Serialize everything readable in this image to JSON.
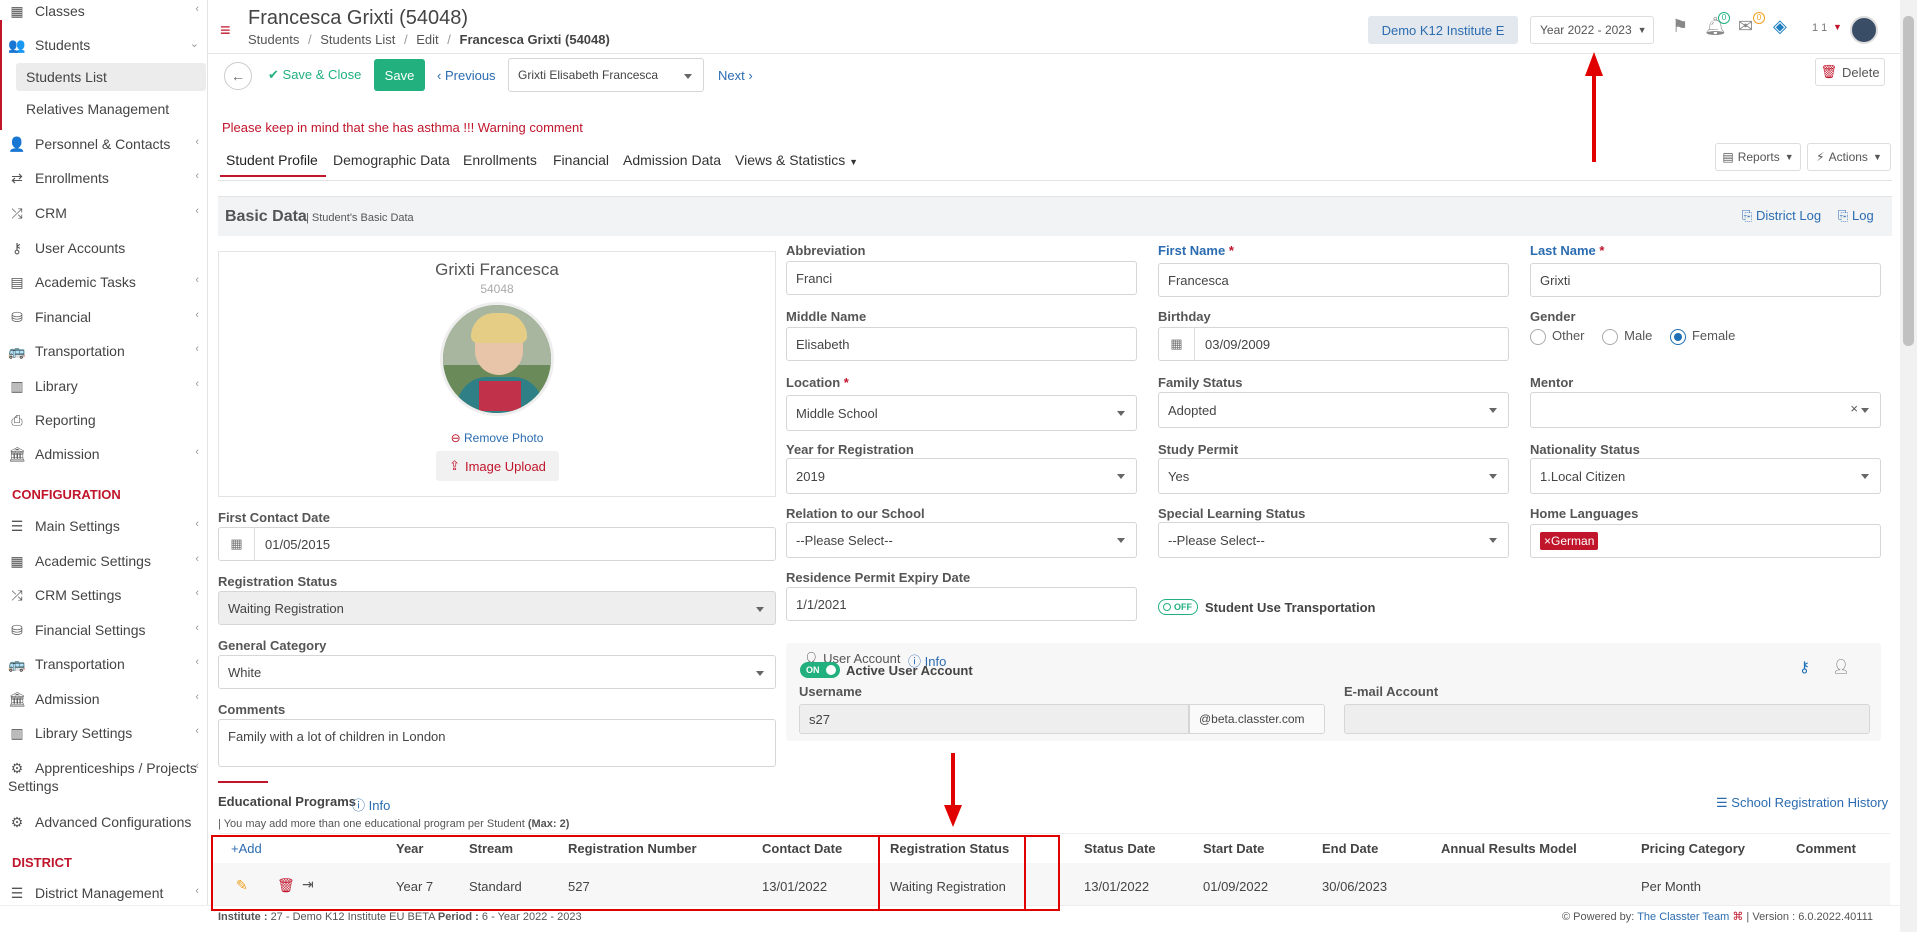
{
  "sidebar": {
    "items": [
      {
        "label": "Classes",
        "icon": "classes-icon"
      },
      {
        "label": "Students",
        "icon": "students-icon"
      },
      {
        "label": "Students List"
      },
      {
        "label": "Relatives Management"
      },
      {
        "label": "Personnel & Contacts",
        "icon": "personnel-icon"
      },
      {
        "label": "Enrollments",
        "icon": "enrollments-icon"
      },
      {
        "label": "CRM",
        "icon": "crm-icon"
      },
      {
        "label": "User Accounts",
        "icon": "key-icon"
      },
      {
        "label": "Academic Tasks",
        "icon": "tasks-icon"
      },
      {
        "label": "Financial",
        "icon": "financial-icon"
      },
      {
        "label": "Transportation",
        "icon": "bus-icon"
      },
      {
        "label": "Library",
        "icon": "library-icon"
      },
      {
        "label": "Reporting",
        "icon": "printer-icon"
      },
      {
        "label": "Admission",
        "icon": "admission-icon"
      }
    ],
    "config_heading": "CONFIGURATION",
    "config_items": [
      {
        "label": "Main Settings"
      },
      {
        "label": "Academic Settings"
      },
      {
        "label": "CRM Settings"
      },
      {
        "label": "Financial Settings"
      },
      {
        "label": "Transportation"
      },
      {
        "label": "Admission"
      },
      {
        "label": "Library Settings"
      },
      {
        "label": "Apprenticeships / Projects"
      },
      {
        "label": "Settings"
      },
      {
        "label": "Advanced Configurations"
      }
    ],
    "district_heading": "DISTRICT",
    "district_items": [
      {
        "label": "District Management"
      }
    ]
  },
  "header": {
    "title": "Francesca Grixti (54048)",
    "breadcrumb": [
      "Students",
      "Students List",
      "Edit",
      "Francesca Grixti (54048)"
    ],
    "breadcrumb_sep": "/",
    "institute": "Demo K12 Institute E",
    "year": "Year 2022 - 2023",
    "notif_count": "0",
    "mail_count": "0",
    "user_label": "1 1"
  },
  "toolbar": {
    "save_close": "Save & Close",
    "save": "Save",
    "previous": "Previous",
    "student_select": "Grixti Elisabeth Francesca",
    "next": "Next",
    "delete": "Delete"
  },
  "warning": "Please keep in mind that she has asthma !!! Warning comment",
  "tabs": [
    "Student Profile",
    "Demographic Data",
    "Enrollments",
    "Financial",
    "Admission Data",
    "Views & Statistics"
  ],
  "reports": "Reports",
  "actions": "Actions",
  "section": {
    "title": "Basic Data",
    "subtitle": "| Student's Basic Data",
    "district_log": "District Log",
    "log": "Log"
  },
  "profile": {
    "name": "Grixti Francesca",
    "id": "54048",
    "remove_photo": "Remove Photo",
    "image_upload": "Image Upload"
  },
  "fields": {
    "abbreviation": {
      "label": "Abbreviation",
      "value": "Franci"
    },
    "first_name": {
      "label": "First Name",
      "value": "Francesca"
    },
    "last_name": {
      "label": "Last Name",
      "value": "Grixti"
    },
    "middle_name": {
      "label": "Middle Name",
      "value": "Elisabeth"
    },
    "birthday": {
      "label": "Birthday",
      "value": "03/09/2009"
    },
    "gender": {
      "label": "Gender",
      "options": [
        "Other",
        "Male",
        "Female"
      ],
      "selected": "Female"
    },
    "location": {
      "label": "Location",
      "value": "Middle School"
    },
    "family_status": {
      "label": "Family Status",
      "value": "Adopted"
    },
    "mentor": {
      "label": "Mentor",
      "value": ""
    },
    "year_registration": {
      "label": "Year for Registration",
      "value": "2019"
    },
    "study_permit": {
      "label": "Study Permit",
      "value": "Yes"
    },
    "nationality": {
      "label": "Nationality Status",
      "value": "1.Local Citizen"
    },
    "first_contact": {
      "label": "First Contact Date",
      "value": "01/05/2015"
    },
    "relation": {
      "label": "Relation to our School",
      "value": "--Please Select--"
    },
    "special_learning": {
      "label": "Special Learning Status",
      "value": "--Please Select--"
    },
    "home_languages": {
      "label": "Home Languages",
      "value": "German"
    },
    "registration_status": {
      "label": "Registration Status",
      "value": "Waiting Registration"
    },
    "residence_permit": {
      "label": "Residence Permit Expiry Date",
      "value": "1/1/2021"
    },
    "transport": {
      "label": "Student Use Transportation",
      "toggle": "OFF"
    },
    "general_category": {
      "label": "General Category",
      "value": "White"
    },
    "comments": {
      "label": "Comments",
      "value": "Family with a lot of children in London"
    }
  },
  "user_account": {
    "title": "User Account",
    "info": "Info",
    "toggle": "ON",
    "active_label": "Active User Account",
    "username_label": "Username",
    "username": "s27",
    "domain": "@beta.classter.com",
    "email_label": "E-mail Account",
    "email": ""
  },
  "programs": {
    "title": "Educational Programs",
    "info": "Info",
    "note": "| You may add more than one educational program per Student",
    "max": "(Max: 2)",
    "history": "School Registration History",
    "add": "Add",
    "headers": [
      "Year",
      "Stream",
      "Registration Number",
      "Contact Date",
      "Registration Status",
      "Status Date",
      "Start Date",
      "End Date",
      "Annual Results Model",
      "Pricing Category",
      "Comment"
    ],
    "row": [
      "Year 7",
      "Standard",
      "527",
      "13/01/2022",
      "Waiting Registration",
      "13/01/2022",
      "01/09/2022",
      "30/06/2023",
      "",
      "Per Month",
      ""
    ]
  },
  "footer": {
    "institute_label": "Institute :",
    "institute": "27 - Demo K12 Institute EU BETA",
    "period_label": "Period :",
    "period": "6 - Year 2022 - 2023",
    "powered": "Powered by:",
    "team": "The Classter Team",
    "version": "| Version : 6.0.2022.40111"
  },
  "colors": {
    "accent": "#2b6cb0",
    "brand_red": "#c0152b",
    "save_green": "#21b07e",
    "annotation": "#e00000"
  }
}
